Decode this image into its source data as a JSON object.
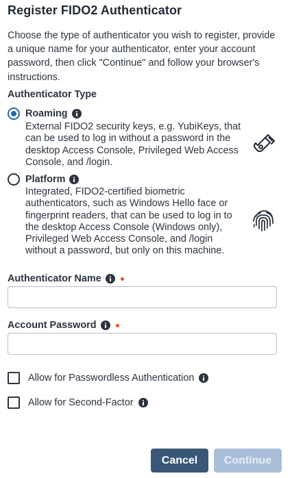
{
  "title": "Register FIDO2 Authenticator",
  "intro": "Choose the type of authenticator you wish to register, provide a unique name for your authenticator, enter your account password, then click \"Continue\" and follow your browser's instructions.",
  "authenticator_type": {
    "label": "Authenticator Type",
    "options": [
      {
        "label": "Roaming",
        "selected": true,
        "icon": "usb-key-icon",
        "desc_lines": [
          "External FIDO2 security keys, e.g. YubiKeys, that",
          "can be used to log in without a password in the",
          "desktop Access Console, Privileged Web Access",
          "Console, and /login."
        ]
      },
      {
        "label": "Platform",
        "selected": false,
        "icon": "fingerprint-icon",
        "desc_lines": [
          "Integrated, FIDO2-certified biometric",
          "authenticators, such as Windows Hello face or",
          "fingerprint readers, that can be used to log in to",
          "the desktop Access Console (Windows only),",
          "Privileged Web Access Console, and /login",
          "without a password, but only on this machine."
        ]
      }
    ]
  },
  "fields": {
    "authenticator_name": {
      "label": "Authenticator Name",
      "value": "",
      "required": true
    },
    "account_password": {
      "label": "Account Password",
      "value": "",
      "required": true
    }
  },
  "checkboxes": {
    "passwordless": {
      "label": "Allow for Passwordless Authentication",
      "checked": false
    },
    "second_factor": {
      "label": "Allow for Second-Factor",
      "checked": false
    }
  },
  "buttons": {
    "cancel": "Cancel",
    "continue": "Continue",
    "continue_disabled": true
  },
  "colors": {
    "accent": "#2566b0",
    "required": "#e2551a",
    "cancel_bg": "#3a5778",
    "continue_disabled_bg": "#a9bfd9"
  }
}
